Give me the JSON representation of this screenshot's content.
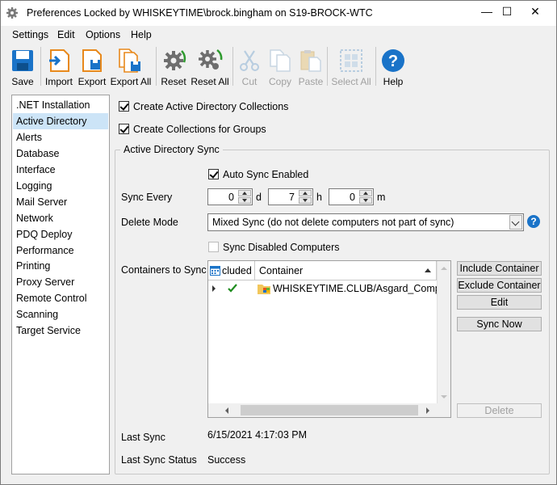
{
  "window": {
    "title": "Preferences Locked by WHISKEYTIME\\brock.bingham on S19-BROCK-WTC",
    "minimize_glyph": "—",
    "maximize_glyph": "☐",
    "close_glyph": "✕"
  },
  "menu": [
    "Settings",
    "Edit",
    "Options",
    "Help"
  ],
  "toolbar": {
    "save": "Save",
    "import": "Import",
    "export": "Export",
    "export_all": "Export All",
    "reset": "Reset",
    "reset_all": "Reset All",
    "cut": "Cut",
    "copy": "Copy",
    "paste": "Paste",
    "select_all": "Select All",
    "help": "Help"
  },
  "sidebar": {
    "items": [
      ".NET Installation",
      "Active Directory",
      "Alerts",
      "Database",
      "Interface",
      "Logging",
      "Mail Server",
      "Network",
      "PDQ Deploy",
      "Performance",
      "Printing",
      "Proxy Server",
      "Remote Control",
      "Scanning",
      "Target Service"
    ],
    "selected": "Active Directory"
  },
  "main": {
    "create_ad_collections": "Create Active Directory Collections",
    "create_group_collections": "Create Collections for Groups",
    "group_title": "Active Directory Sync",
    "auto_sync": "Auto Sync Enabled",
    "sync_every_label": "Sync Every",
    "days_value": "0",
    "days_unit": "d",
    "hours_value": "7",
    "hours_unit": "h",
    "minutes_value": "0",
    "minutes_unit": "m",
    "delete_mode_label": "Delete Mode",
    "delete_mode_value": "Mixed Sync (do not delete computers not part of sync)",
    "help_glyph": "?",
    "sync_disabled": "Sync Disabled Computers",
    "containers_label": "Containers to Sync",
    "grid": {
      "col_included": "cluded",
      "col_container": "Container",
      "rows": [
        {
          "container": "WHISKEYTIME.CLUB/Asgard_Comp..."
        }
      ]
    },
    "btn_include": "Include Container",
    "btn_exclude": "Exclude Container",
    "btn_edit": "Edit",
    "btn_sync_now": "Sync Now",
    "btn_delete": "Delete",
    "last_sync_label": "Last Sync",
    "last_sync_value": "6/15/2021 4:17:03 PM",
    "last_sync_status_label": "Last Sync Status",
    "last_sync_status_value": "Success"
  },
  "colors": {
    "accent_blue": "#1a73c8",
    "selection": "#cce4f7",
    "orange": "#e8891c",
    "green_check": "#1e8c1e"
  }
}
